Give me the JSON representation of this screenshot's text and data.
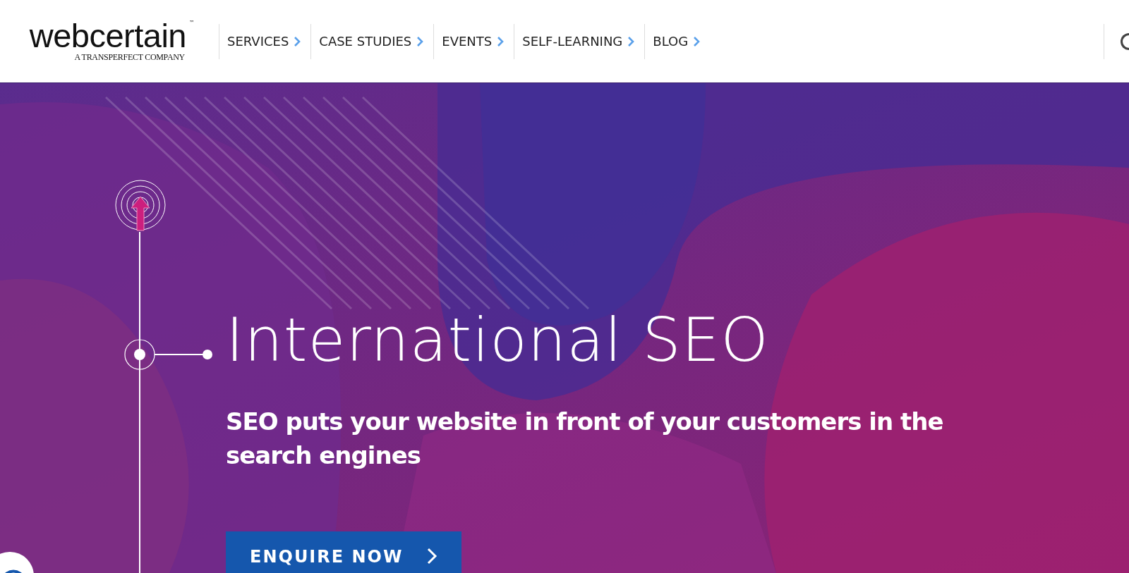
{
  "header": {
    "logo": {
      "wordmark": "webcertain",
      "trademark": "™",
      "tagline": "A TRANSPERFECT COMPANY"
    },
    "nav": [
      {
        "label": "SERVICES"
      },
      {
        "label": "CASE STUDIES"
      },
      {
        "label": "EVENTS"
      },
      {
        "label": "SELF-LEARNING"
      },
      {
        "label": "BLOG"
      }
    ]
  },
  "hero": {
    "kind": "picture",
    "title": "International SEO",
    "subtitle": "SEO puts your website in front of your customers in the search engines",
    "button": {
      "label": "ENQUIRE NOW"
    }
  }
}
